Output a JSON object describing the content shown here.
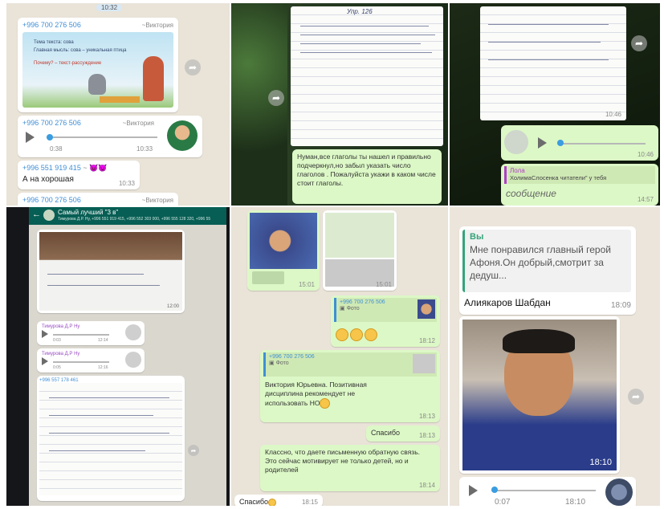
{
  "panel1": {
    "top_time": "10:32",
    "msg1_phone": "+996 700 276 506",
    "msg1_name": "~Виктория",
    "slide_line1": "Тема текста: сова",
    "slide_line2": "Главная мысль: сова – уникальная птица",
    "slide_line3": "Почему? – текст-рассуждение",
    "msg1_time": "10:32",
    "audio_phone": "+996 700 276 506",
    "audio_name": "~Виктория",
    "audio_duration": "0:38",
    "audio_time": "10:33",
    "msg3_phone": "+996 551 919 415",
    "msg3_name": "~",
    "msg3_text": "А на хорошая",
    "msg3_time": "10:33",
    "msg4_phone": "+996 700 276 506",
    "msg4_name": "~Виктория"
  },
  "panel2": {
    "notebook_line1": "Упр. 126",
    "reply_text": "Нуман,все глаголы ты нашел и правильно подчеркнул,но забыл указать число глаголов . Пожалуйста укажи в каком числе стоит глаголы."
  },
  "panel3": {
    "photo_time": "10:46",
    "audio_time": "10:46",
    "quote_name": "Лола",
    "quote_text": "ХолимаСлосенка читатели\" у тебя",
    "footer_text": "сообщение",
    "footer_time": "14:57"
  },
  "panel4": {
    "chat_title": "Самый лучший \"3 в\"",
    "chat_members": "Тимурова Д.Р. Ну, +996 551 919 415, +996 552 303 000, +996 555 128 320, +996 556 222 0...",
    "photo_time": "12:00",
    "voice1_name": "Тимурова Д.Р Ну",
    "voice1_duration": "0:03",
    "voice1_time": "12:14",
    "voice2_name": "Тимурова Д.Р Ну",
    "voice2_duration": "0:05",
    "voice2_time": "12:16",
    "photo2_header": "+996 557 178 461"
  },
  "panel5": {
    "thumb1_time": "15:01",
    "thumb2_time": "15:01",
    "msg1_phone": "+996 700 276 506",
    "msg1_label": "Фото",
    "msg1_time": "18:12",
    "msg2_phone": "+996 700 276 506",
    "msg2_label": "Фото",
    "msg2_text": "Виктория Юрьевна. Позитивная дисциплина рекомендует не использовать НО",
    "msg2_time": "18:13",
    "msg3_text": "Спасибо",
    "msg3_time": "18:13",
    "msg4_text": "Классно, что даете письменную обратную связь. Это сейчас мотивирует не только детей, но и родителей",
    "msg4_time": "18:14",
    "msg5_text": "Спасибо",
    "msg5_time": "18:15"
  },
  "panel6": {
    "quote_author": "Вы",
    "quote_text": "Мне понравился главный герой Афоня.Он добрый,смотрит за дедуш...",
    "reply_name": "Алиякаров Шабдан",
    "reply_time": "18:09",
    "photo_time": "18:10",
    "audio_duration": "0:07",
    "audio_time": "18:10"
  }
}
